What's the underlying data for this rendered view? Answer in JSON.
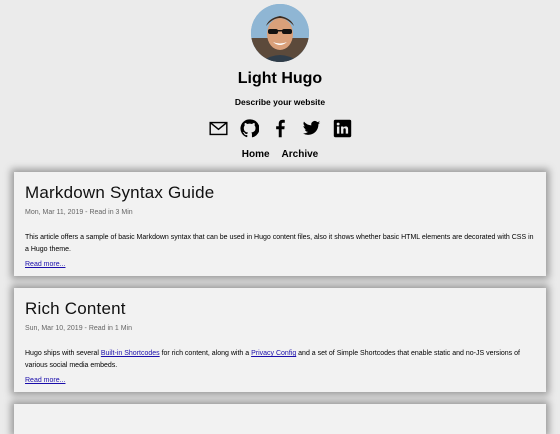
{
  "site": {
    "title": "Light Hugo",
    "description": "Describe your website"
  },
  "social": [
    {
      "name": "email",
      "icon": "envelope-icon"
    },
    {
      "name": "github",
      "icon": "github-icon"
    },
    {
      "name": "facebook",
      "icon": "facebook-icon"
    },
    {
      "name": "twitter",
      "icon": "twitter-icon"
    },
    {
      "name": "linkedin",
      "icon": "linkedin-icon"
    }
  ],
  "nav": {
    "home": "Home",
    "archive": "Archive"
  },
  "posts": [
    {
      "title": "Markdown Syntax Guide",
      "meta": "Mon, Mar 11, 2019 - Read in 3 Min",
      "summary": "This article offers a sample of basic Markdown syntax that can be used in Hugo content files, also it shows whether basic HTML elements are decorated with CSS in a Hugo theme.",
      "read_more": "Read more..."
    },
    {
      "title": "Rich Content",
      "meta": "Sun, Mar 10, 2019 - Read in 1 Min",
      "summary_pre": "Hugo ships with several ",
      "link1": "Built-in Shortcodes",
      "summary_mid": " for rich content, along with a ",
      "link2": "Privacy Config",
      "summary_post": " and a set of Simple Shortcodes that enable static and no-JS versions of various social media embeds.",
      "read_more": "Read more..."
    }
  ],
  "colors": {
    "background": "#ebebeb",
    "card": "#f2f2f2",
    "link": "#1a0dab",
    "meta": "#666666"
  }
}
